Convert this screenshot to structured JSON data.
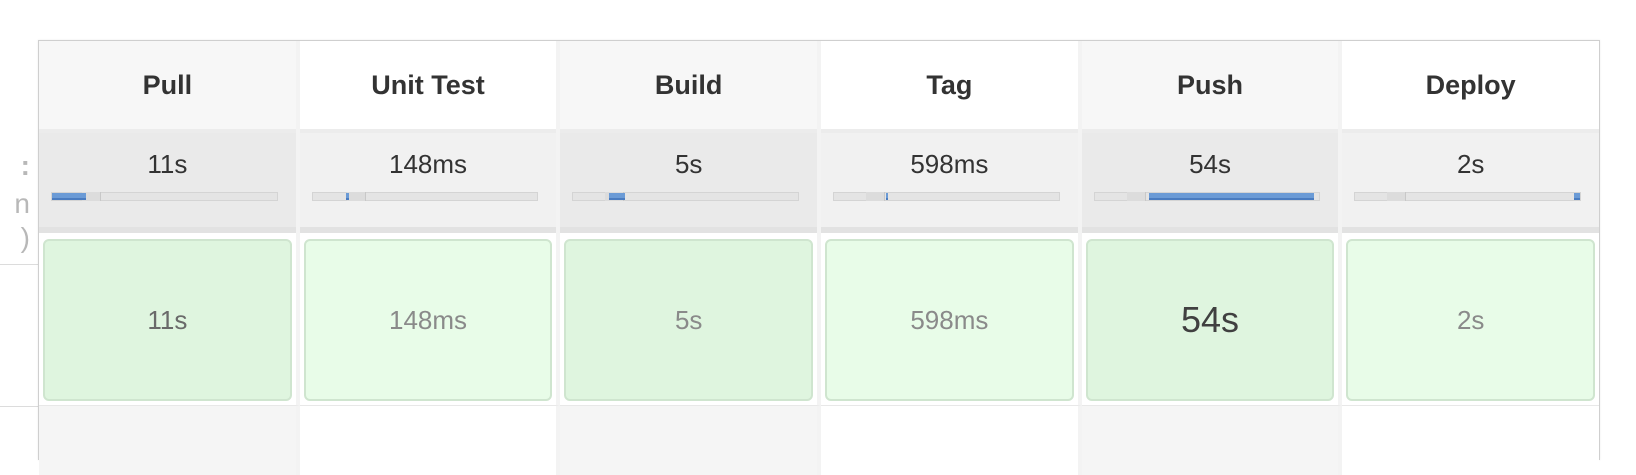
{
  "left_fragments": [
    ":",
    "n",
    ")"
  ],
  "stages": [
    {
      "name": "Pull",
      "avg_time": "11s",
      "run_time": "11s",
      "fill_start": 0.0,
      "fill_end": 0.15
    },
    {
      "name": "Unit Test",
      "avg_time": "148ms",
      "run_time": "148ms",
      "fill_start": 0.15,
      "fill_end": 0.16
    },
    {
      "name": "Build",
      "avg_time": "5s",
      "run_time": "5s",
      "fill_start": 0.16,
      "fill_end": 0.23
    },
    {
      "name": "Tag",
      "avg_time": "598ms",
      "run_time": "598ms",
      "fill_start": 0.23,
      "fill_end": 0.24
    },
    {
      "name": "Push",
      "avg_time": "54s",
      "run_time": "54s",
      "fill_start": 0.24,
      "fill_end": 0.975
    },
    {
      "name": "Deploy",
      "avg_time": "2s",
      "run_time": "2s",
      "fill_start": 0.975,
      "fill_end": 1.0
    }
  ],
  "colors": {
    "timeline_fill": "#6b9bd6",
    "success_bg": "#dff5df",
    "success_bg_alt": "#e8fce8",
    "success_border": "#cfe5cf"
  }
}
